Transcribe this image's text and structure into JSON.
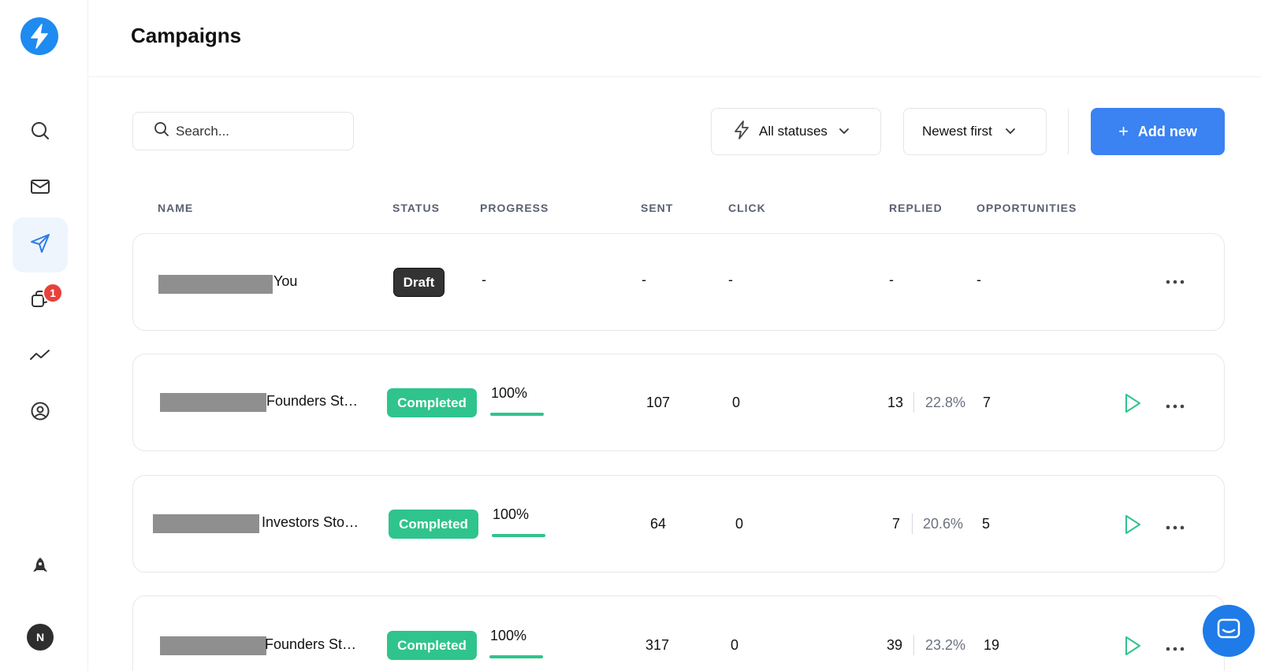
{
  "app": {
    "title": "Campaigns",
    "brand_color": "#1e8bf0",
    "accent_color": "#3b82f2",
    "success_color": "#2fc48d"
  },
  "sidebar": {
    "items": [
      {
        "icon": "search-icon"
      },
      {
        "icon": "mail-icon"
      },
      {
        "icon": "send-icon",
        "active": true
      },
      {
        "icon": "copy-icon",
        "badge": "1"
      },
      {
        "icon": "analytics-icon"
      },
      {
        "icon": "user-circle-icon"
      }
    ],
    "bottom": {
      "rocket_icon": "rocket-icon",
      "avatar_initial": "N"
    }
  },
  "toolbar": {
    "search_placeholder": "Search...",
    "status_filter": "All statuses",
    "sort": "Newest first",
    "add_label": "Add new"
  },
  "table": {
    "columns": [
      "NAME",
      "STATUS",
      "PROGRESS",
      "SENT",
      "CLICK",
      "REPLIED",
      "OPPORTUNITIES"
    ],
    "rows": [
      {
        "name": "You",
        "status": "Draft",
        "progress": "-",
        "progress_value": null,
        "sent": "-",
        "click": "-",
        "replied": "-",
        "replied_rate": "",
        "opportunities": "-"
      },
      {
        "name": "Founders St…",
        "status": "Completed",
        "progress": "100%",
        "progress_value": 1.0,
        "sent": "107",
        "click": "0",
        "replied": "13",
        "replied_rate": "22.8%",
        "opportunities": "7"
      },
      {
        "name": "Investors Sto…",
        "status": "Completed",
        "progress": "100%",
        "progress_value": 1.0,
        "sent": "64",
        "click": "0",
        "replied": "7",
        "replied_rate": "20.6%",
        "opportunities": "5"
      },
      {
        "name": "Founders St…",
        "status": "Completed",
        "progress": "100%",
        "progress_value": 1.0,
        "sent": "317",
        "click": "0",
        "replied": "39",
        "replied_rate": "23.2%",
        "opportunities": "19"
      }
    ]
  }
}
